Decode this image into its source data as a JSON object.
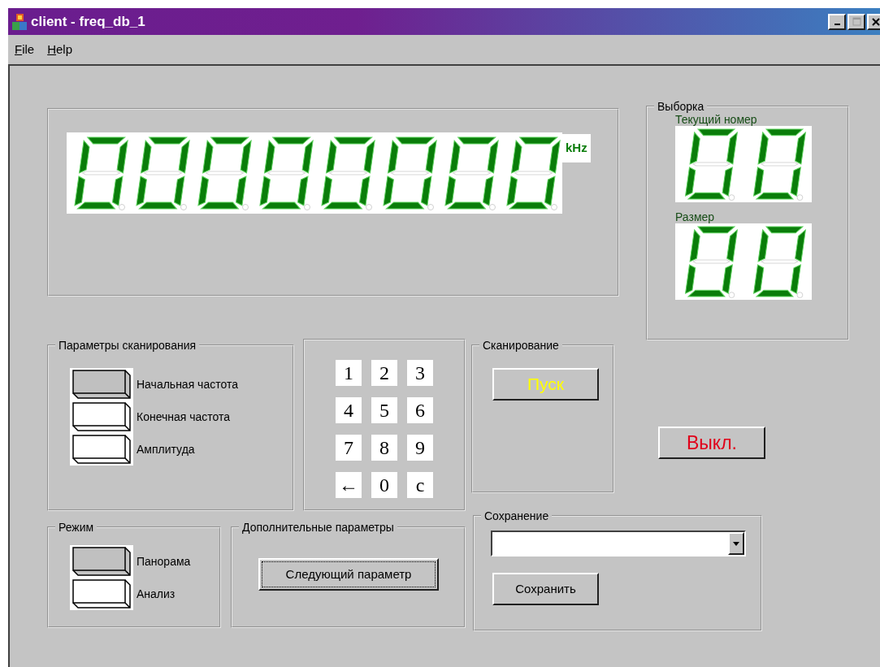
{
  "window": {
    "title": "client - freq_db_1",
    "controls": [
      {
        "kind": "minimize",
        "disabled": false
      },
      {
        "kind": "maximize",
        "disabled": true
      },
      {
        "kind": "close",
        "disabled": false
      }
    ]
  },
  "menu": [
    {
      "label": "File",
      "mnemonic": true
    },
    {
      "label": "Help",
      "mnemonic": true
    }
  ],
  "frequency_display": {
    "unit": "kHz"
  },
  "sample": {
    "title": "Выборка",
    "current": {
      "label": "Текущий номер"
    },
    "size": {
      "label": "Размер"
    }
  },
  "scan_params": {
    "title": "Параметры сканирования",
    "options": [
      {
        "label": "Начальная частота",
        "selected": true
      },
      {
        "label": "Конечная частота",
        "selected": false
      },
      {
        "label": "Амплитуда",
        "selected": false
      }
    ]
  },
  "keypad": {
    "keys": [
      "1",
      "2",
      "3",
      "4",
      "5",
      "6",
      "7",
      "8",
      "9",
      "←",
      "0",
      "c"
    ]
  },
  "scan": {
    "title": "Сканирование",
    "start_button": "Пуск"
  },
  "off_button": "Выкл.",
  "mode": {
    "title": "Режим",
    "options": [
      {
        "label": "Панорама",
        "selected": true
      },
      {
        "label": "Анализ",
        "selected": false
      }
    ]
  },
  "extra": {
    "title": "Дополнительные параметры",
    "button": {
      "label": "Следующий параметр",
      "focused": true
    }
  },
  "save": {
    "title": "Сохранение",
    "button": "Сохранить"
  }
}
